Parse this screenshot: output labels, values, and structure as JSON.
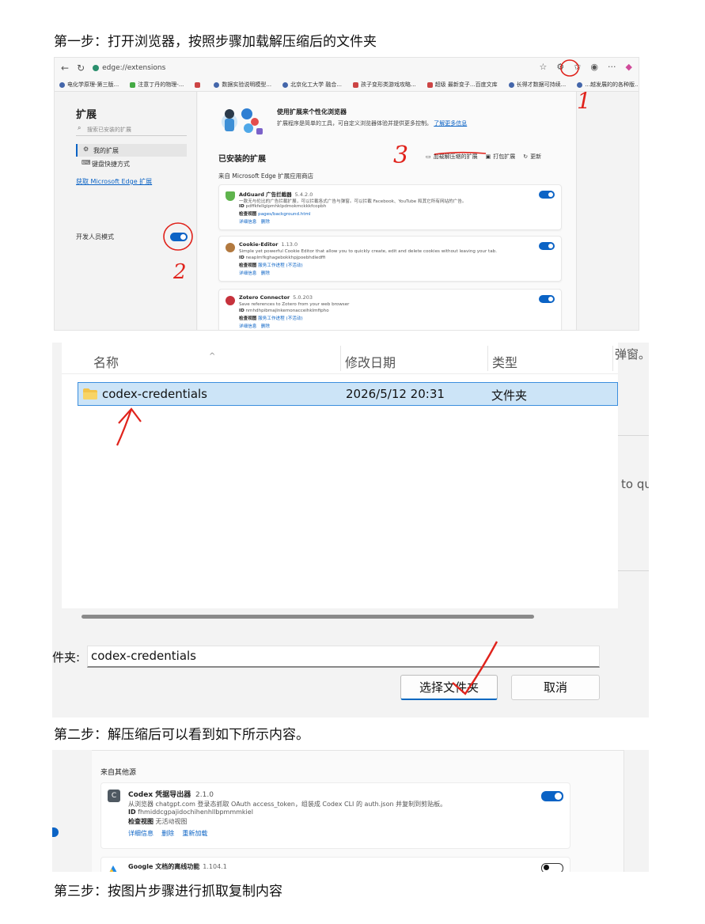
{
  "doc": {
    "step1": "第一步：打开浏览器，按照步骤加载解压缩后的文件夹",
    "step2": "第二步：解压缩后可以看到如下所示内容。",
    "step3": "第三步：按图片步骤进行抓取复制内容"
  },
  "browser": {
    "url": "edge://extensions",
    "bookmarks": [
      "电化学原理-第三版...",
      "注意丁丹的物理-...",
      "",
      "数据实验说明模型...",
      "北京化工大学 融合...",
      "孩子变形类游戏攻略...",
      "超级 最新变子...百度文库",
      "长得才数据可持续...",
      "...越发展的的各种版..."
    ],
    "sidebar": {
      "title": "扩展",
      "search_placeholder": "搜索已安装的扩展",
      "my_extensions": "我的扩展",
      "shortcuts": "键盘快捷方式",
      "get_extensions": "获取 Microsoft Edge 扩展",
      "dev_mode": "开发人员模式"
    },
    "promo": {
      "title": "使用扩展来个性化浏览器",
      "desc": "扩展程序是简单的工具，可自定义浏览器体验并提供更多控制。",
      "link": "了解更多信息"
    },
    "installed_title": "已安装的扩展",
    "tools": {
      "load_unpacked": "加载解压缩的扩展",
      "pack": "打包扩展",
      "update": "更新"
    },
    "store_label": "来自 Microsoft Edge 扩展应用商店",
    "extensions": [
      {
        "name": "AdGuard 广告拦截器",
        "version": "5.4.2.0",
        "desc": "一款无与伦比的广告拦截扩展，可以拦截各式广告与弹窗。可以拦截 Facebook、YouTube 和其它所有网站的广告。",
        "id_label": "ID",
        "id": "pdffkfellgipmhklpdmokmckkkfcopbh",
        "inspect_label": "检查视图",
        "inspect_value": "pages/background.html",
        "details": "详细信息",
        "remove": "删除"
      },
      {
        "name": "Cookie-Editor",
        "version": "1.13.0",
        "desc": "Simple yet powerful Cookie Editor that allow you to quickly create, edit and delete cookies without leaving your tab.",
        "id_label": "ID",
        "id": "neaplmfkghagebokkhpjpoebhdledffi",
        "inspect_label": "检查视图",
        "inspect_value": "服务工作进程 (不活动)",
        "details": "详细信息",
        "remove": "删除"
      },
      {
        "name": "Zotero Connector",
        "version": "5.0.203",
        "desc": "Save references to Zotero from your web browser",
        "id_label": "ID",
        "id": "nmhdhpibmajlnkemonacceihklmfipho",
        "inspect_label": "检查视图",
        "inspect_value": "服务工作进程 (不活动)",
        "details": "详细信息",
        "remove": "删除"
      }
    ]
  },
  "annotations": {
    "one": "1",
    "two": "2",
    "three": "3"
  },
  "file_dialog": {
    "col_name": "名称",
    "col_date": "修改日期",
    "col_type": "类型",
    "row": {
      "name": "codex-credentials",
      "date": "2026/5/12 20:31",
      "type": "文件夹"
    },
    "folder_label": "件夹:",
    "folder_value": "codex-credentials",
    "select_button": "选择文件夹",
    "cancel_button": "取消",
    "ghost_right_1": "弹窗。",
    "ghost_right_2": "to qu"
  },
  "unpacked": {
    "source_label": "来自其他源",
    "ext": {
      "logo_letter": "C",
      "name": "Codex 凭据导出器",
      "version": "2.1.0",
      "desc": "从浏览器 chatgpt.com 登录态抓取 OAuth access_token，组装成 Codex CLI 的 auth.json 并复制到剪贴板。",
      "id_label": "ID",
      "id": "fhmiddcgpajidochihenhllbpmmmkiel",
      "inspect_label": "检查视图",
      "inspect_value": "无活动视图",
      "details": "详细信息",
      "remove": "删除",
      "reload": "重新加载"
    },
    "ext2": {
      "name": "Google 文档的离线功能",
      "version": "1.104.1"
    }
  },
  "colors": {
    "accent": "#0b63c5",
    "annotation_red": "#e0231c",
    "selection": "#cce4f7"
  }
}
